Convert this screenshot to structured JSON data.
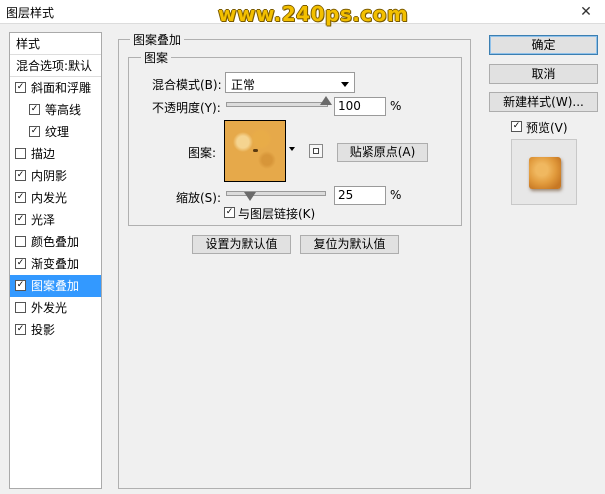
{
  "window": {
    "title": "图层样式",
    "watermark": "www.240ps.com",
    "close_glyph": "✕"
  },
  "styles_list": {
    "header": "样式",
    "blending_options": "混合选项:默认",
    "items": [
      {
        "label": "斜面和浮雕",
        "checked": true,
        "indent": false,
        "selected": false
      },
      {
        "label": "等高线",
        "checked": true,
        "indent": true,
        "selected": false
      },
      {
        "label": "纹理",
        "checked": true,
        "indent": true,
        "selected": false
      },
      {
        "label": "描边",
        "checked": false,
        "indent": false,
        "selected": false
      },
      {
        "label": "内阴影",
        "checked": true,
        "indent": false,
        "selected": false
      },
      {
        "label": "内发光",
        "checked": true,
        "indent": false,
        "selected": false
      },
      {
        "label": "光泽",
        "checked": true,
        "indent": false,
        "selected": false
      },
      {
        "label": "颜色叠加",
        "checked": false,
        "indent": false,
        "selected": false
      },
      {
        "label": "渐变叠加",
        "checked": true,
        "indent": false,
        "selected": false
      },
      {
        "label": "图案叠加",
        "checked": true,
        "indent": false,
        "selected": true
      },
      {
        "label": "外发光",
        "checked": false,
        "indent": false,
        "selected": false
      },
      {
        "label": "投影",
        "checked": true,
        "indent": false,
        "selected": false
      }
    ]
  },
  "panel": {
    "group_title": "图案叠加",
    "subgroup_title": "图案",
    "blend_mode_label": "混合模式(B):",
    "blend_mode_value": "正常",
    "opacity_label": "不透明度(Y):",
    "opacity_value": "100",
    "opacity_fraction": 1.0,
    "percent": "%",
    "pattern_label": "图案:",
    "snap_origin_button": "贴紧原点(A)",
    "scale_label": "缩放(S):",
    "scale_value": "25",
    "scale_fraction": 0.25,
    "link_with_layer_label": "与图层链接(K)",
    "link_with_layer_checked": true,
    "make_default_button": "设置为默认值",
    "reset_default_button": "复位为默认值"
  },
  "actions": {
    "ok_button": "确定",
    "cancel_button": "取消",
    "new_style_button": "新建样式(W)...",
    "preview_label": "预览(V)",
    "preview_checked": true
  },
  "check_glyph": "✓"
}
